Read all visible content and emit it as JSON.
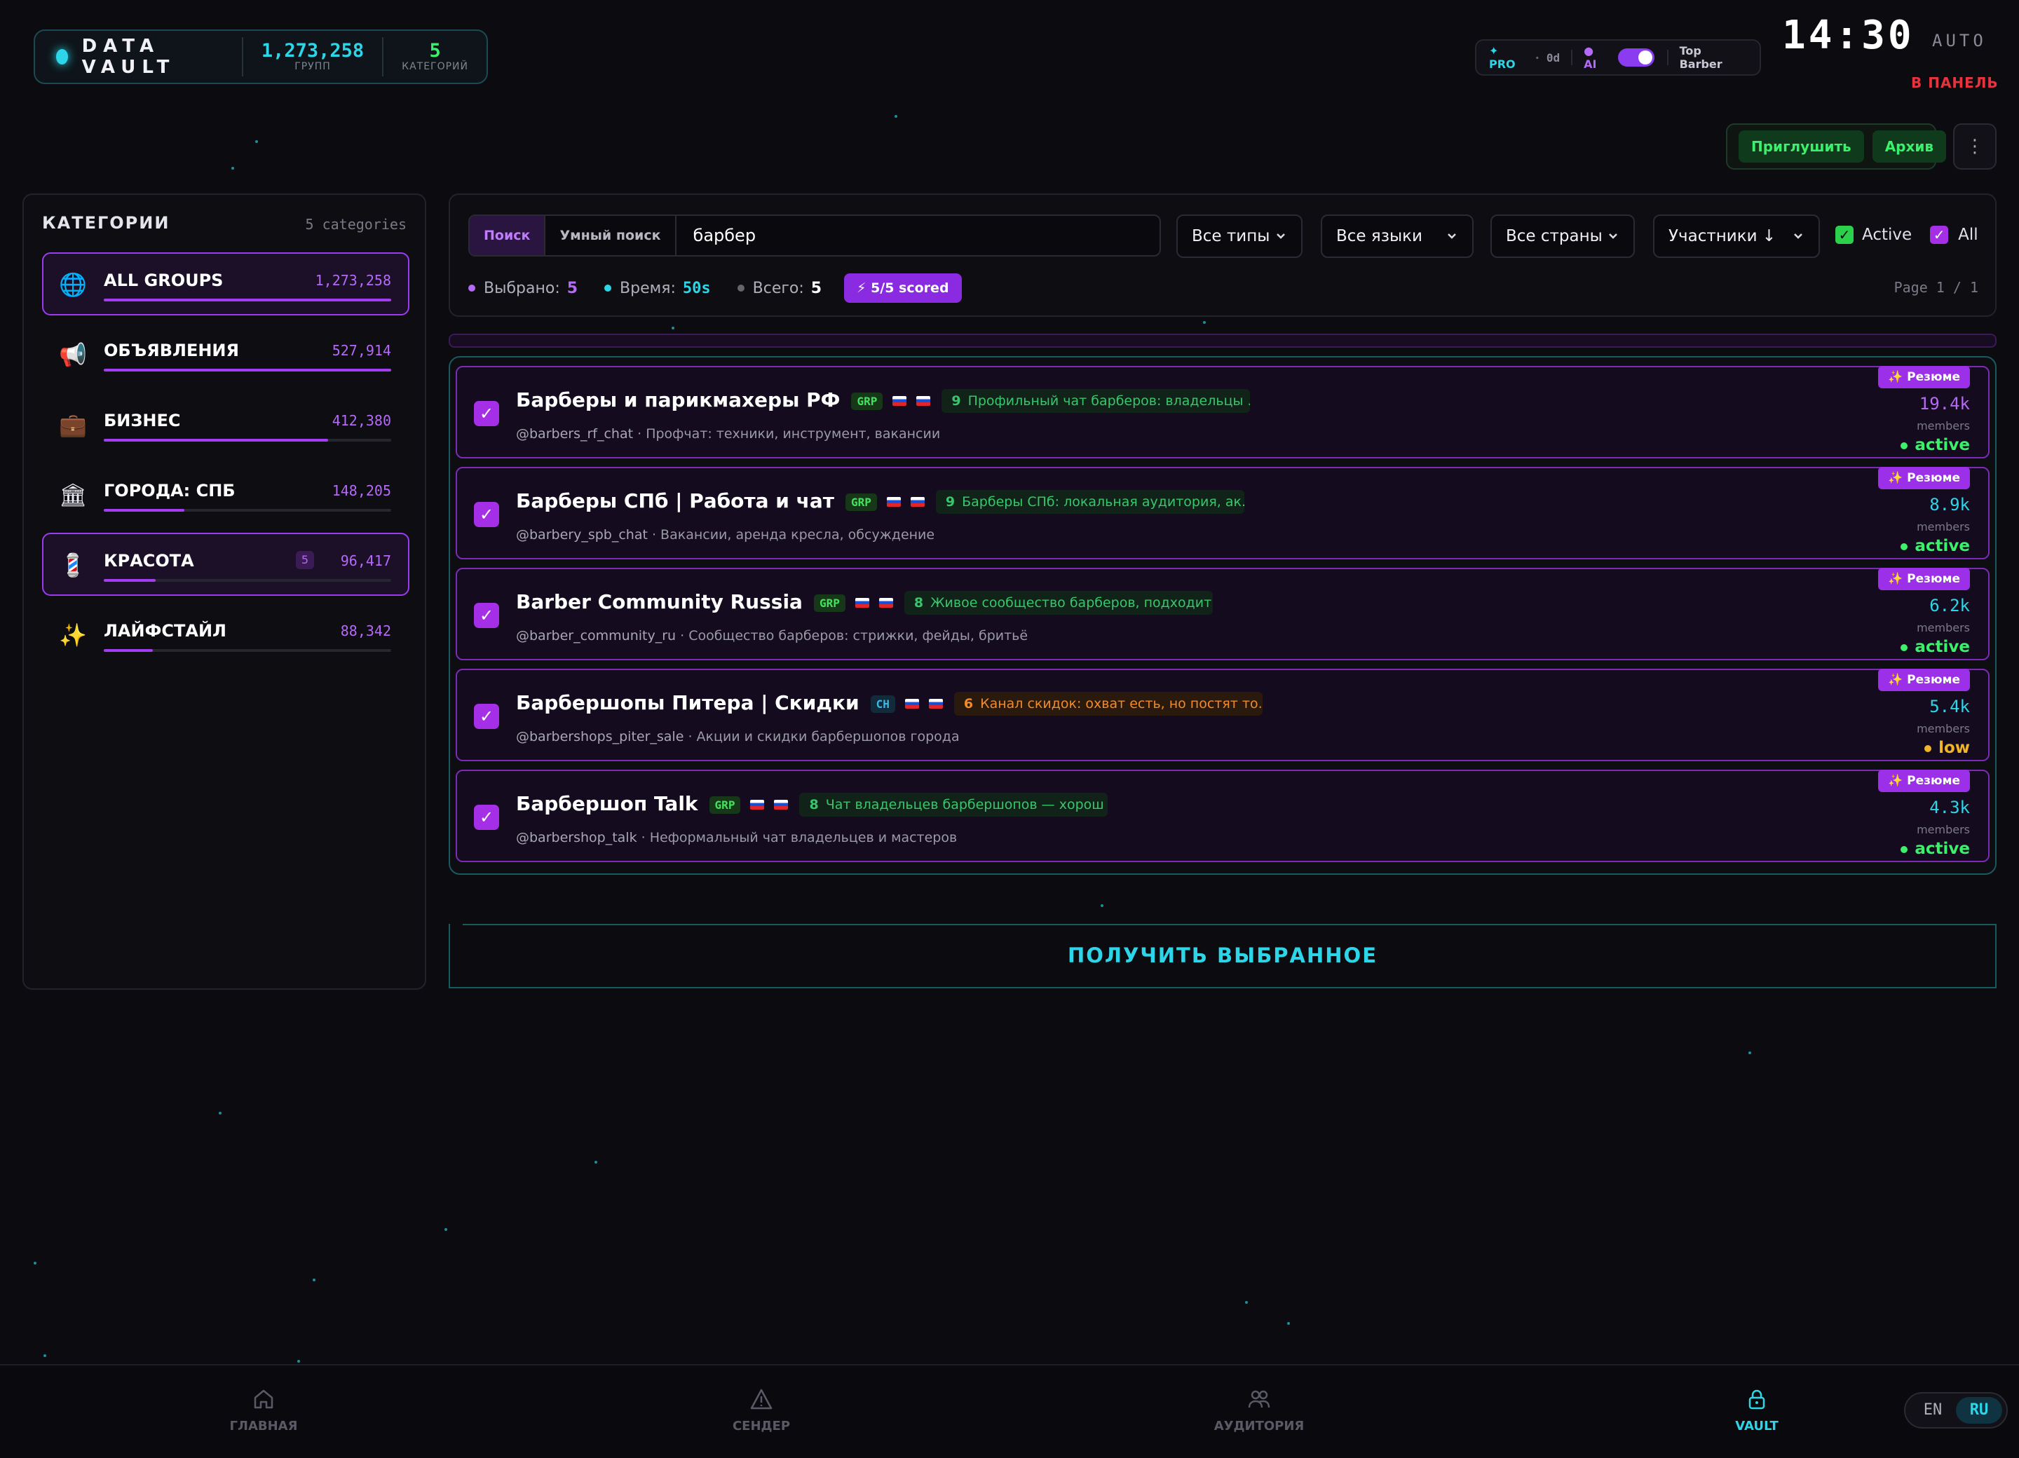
{
  "header": {
    "brand": "DATA VAULT",
    "groups_value": "1,273,258",
    "groups_label": "ГРУПП",
    "categories_value": "5",
    "categories_label": "КАТЕГОРИЙ",
    "plan": "✦ PRO",
    "plan_sep": "·",
    "days": "0d",
    "ai_label": "● AI",
    "profile": "Top Barber",
    "clock": "14:30",
    "auto": "AUTO",
    "panel_link": "В ПАНЕЛЬ"
  },
  "actions": {
    "mute": "Приглушить",
    "archive": "Архив",
    "more": "⋮"
  },
  "categories": {
    "title": "КАТЕГОРИИ",
    "count": "5 categories",
    "items": [
      {
        "icon": "🌐",
        "name": "ALL GROUPS",
        "count": "1,273,258",
        "fill": 1.0
      },
      {
        "icon": "📢",
        "name": "ОБЪЯВЛЕНИЯ",
        "count": "527,914",
        "fill": 1.0
      },
      {
        "icon": "💼",
        "name": "БИЗНЕС",
        "count": "412,380",
        "fill": 0.78
      },
      {
        "icon": "🏛",
        "name": "ГОРОДА: СПБ",
        "count": "148,205",
        "fill": 0.28
      },
      {
        "icon": "💈",
        "name": "КРАСОТА",
        "count": "96,417",
        "badge": "5",
        "fill": 0.18
      },
      {
        "icon": "✨",
        "name": "ЛАЙФСТАЙЛ",
        "count": "88,342",
        "fill": 0.17
      }
    ]
  },
  "search": {
    "tab_search": "Поиск",
    "tab_smart": "Умный поиск",
    "query": "барбер",
    "types": "Все типы",
    "languages": "Все языки",
    "countries": "Все страны",
    "sort": "Участники ↓",
    "active_label": "Active",
    "all_label": "All",
    "selected_label": "Выбрано:",
    "selected_value": "5",
    "time_label": "Время:",
    "time_value": "50s",
    "total_label": "Всего:",
    "total_value": "5",
    "scored": "⚡ 5/5 scored",
    "page": "Page 1 / 1"
  },
  "results": [
    {
      "title": "Барберы и парикмахеры РФ",
      "tag": "GRP",
      "score": "9",
      "summary": "Профильный чат барберов: владельцы ...",
      "score_tone": "good",
      "handle": "@barbers_rf_chat",
      "desc": "· Профчат: техники, инструмент, вакансии",
      "members": "19.4k",
      "members_label": "members",
      "status": "active",
      "badge": "✨ Резюме"
    },
    {
      "title": "Барберы СПб | Работа и чат",
      "tag": "GRP",
      "score": "9",
      "summary": "Барберы СПб: локальная аудитория, ак...",
      "score_tone": "good",
      "handle": "@barbery_spb_chat",
      "desc": "· Вакансии, аренда кресла, обсуждение",
      "members": "8.9k",
      "members_label": "members",
      "status": "active",
      "badge": "✨ Резюме"
    },
    {
      "title": "Barber Community Russia",
      "tag": "GRP",
      "score": "8",
      "summary": "Живое сообщество барберов, подходит...",
      "score_tone": "good",
      "handle": "@barber_community_ru",
      "desc": "· Сообщество барберов: стрижки, фейды, бритьё",
      "members": "6.2k",
      "members_label": "members",
      "status": "active",
      "badge": "✨ Резюме"
    },
    {
      "title": "Барбершопы Питера | Скидки",
      "tag": "CH",
      "score": "6",
      "summary": "Канал скидок: охват есть, но постят то...",
      "score_tone": "warn",
      "handle": "@barbershops_piter_sale",
      "desc": "· Акции и скидки барбершопов города",
      "members": "5.4k",
      "members_label": "members",
      "status": "low",
      "badge": "✨ Резюме"
    },
    {
      "title": "Барбершоп Talk",
      "tag": "GRP",
      "score": "8",
      "summary": "Чат владельцев барбершопов — хорош ...",
      "score_tone": "good",
      "handle": "@barbershop_talk",
      "desc": "· Неформальный чат владельцев и мастеров",
      "members": "4.3k",
      "members_label": "members",
      "status": "active",
      "badge": "✨ Резюме"
    }
  ],
  "get_selected": "ПОЛУЧИТЬ ВЫБРАННОЕ",
  "nav": {
    "home": "ГЛАВНАЯ",
    "sender": "СЕНДЕР",
    "audience": "АУДИТОРИЯ",
    "vault": "VAULT"
  },
  "lang": {
    "en": "EN",
    "ru": "RU"
  },
  "colors": {
    "accent_cyan": "#2cd6e8",
    "accent_purple": "#a23df3",
    "green": "#3bf06a",
    "active": "#3bf06a",
    "low": "#f0b42b",
    "danger": "#e8333e"
  }
}
